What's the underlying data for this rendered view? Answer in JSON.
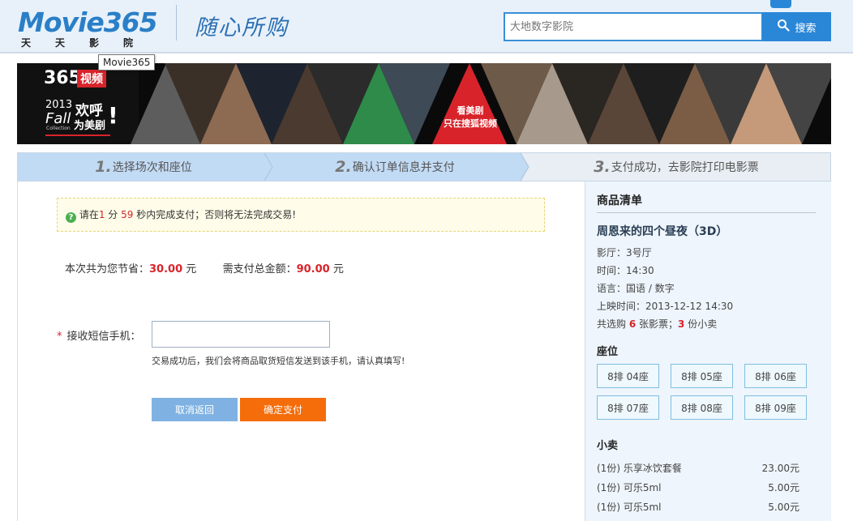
{
  "header": {
    "logo_text": "Movie365",
    "logo_sub": "天天影院",
    "slogan": "随心所购",
    "search_placeholder": "大地数字影院",
    "search_button": "搜索",
    "tooltip": "Movie365"
  },
  "banner": {
    "brand_num": "365",
    "brand_tag": "视频",
    "year": "2013",
    "fall": "Fall",
    "collection": "Collection",
    "huanhu": "欢呼",
    "weimeiju": "为美剧",
    "exclaim": "!",
    "center_line1": "看美剧",
    "center_line2": "只在搜狐视频"
  },
  "steps": [
    {
      "num": "1.",
      "label": "选择场次和座位"
    },
    {
      "num": "2.",
      "label": "确认订单信息并支付"
    },
    {
      "num": "3.",
      "label": "支付成功，去影院打印电影票"
    }
  ],
  "notice": {
    "p1": "请在",
    "min": "1",
    "p2": " 分 ",
    "sec": "59",
    "p3": " 秒内完成支付；否则将无法完成交易!"
  },
  "summary": {
    "save_label": "本次共为您节省：",
    "save_amount": "30.00",
    "save_unit": " 元",
    "total_label": "需支付总金额：",
    "total_amount": "90.00",
    "total_unit": " 元"
  },
  "phone": {
    "star": "*",
    "label": "接收短信手机：",
    "value": "",
    "hint": "交易成功后，我们会将商品取货短信发送到该手机，请认真填写!"
  },
  "buttons": {
    "cancel": "取消返回",
    "confirm": "确定支付"
  },
  "sidebar": {
    "title": "商品清单",
    "movie": "周恩来的四个昼夜（3D）",
    "hall": "影厅：3号厅",
    "time": "时间：14:30",
    "language": "语言：国语 / 数字",
    "showtime": "上映时间：2013-12-12 14:30",
    "count_p1": "共选购 ",
    "ticket_count": "6",
    "count_p2": " 张影票；",
    "snack_count": "3",
    "count_p3": " 份小卖",
    "seat_title": "座位",
    "seats": [
      "8排 04座",
      "8排 05座",
      "8排 06座",
      "8排 07座",
      "8排 08座",
      "8排 09座"
    ],
    "snack_title": "小卖",
    "snacks": [
      {
        "name": "(1份) 乐享冰饮套餐",
        "price": "23.00元"
      },
      {
        "name": "(1份) 可乐5ml",
        "price": "5.00元"
      },
      {
        "name": "(1份) 可乐5ml",
        "price": "5.00元"
      }
    ]
  },
  "colors": {
    "accent": "#2a87d8",
    "confirm": "#f56d0b",
    "cancel": "#7fb2e2",
    "highlight": "#d8232a"
  }
}
